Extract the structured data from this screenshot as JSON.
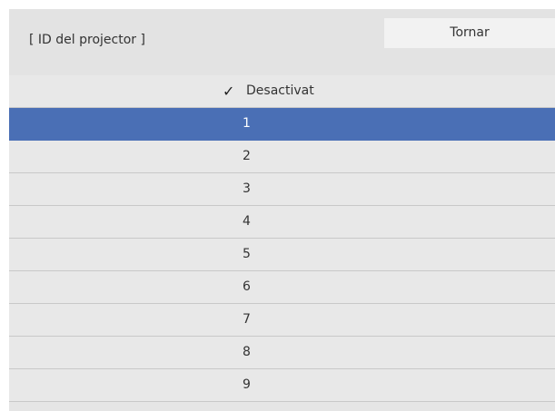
{
  "header": {
    "title": "[ ID del projector ]",
    "back_label": "Tornar"
  },
  "list": {
    "items": [
      {
        "label": "Desactivat",
        "checked": true,
        "selected": false
      },
      {
        "label": "1",
        "checked": false,
        "selected": true
      },
      {
        "label": "2",
        "checked": false,
        "selected": false
      },
      {
        "label": "3",
        "checked": false,
        "selected": false
      },
      {
        "label": "4",
        "checked": false,
        "selected": false
      },
      {
        "label": "5",
        "checked": false,
        "selected": false
      },
      {
        "label": "6",
        "checked": false,
        "selected": false
      },
      {
        "label": "7",
        "checked": false,
        "selected": false
      },
      {
        "label": "8",
        "checked": false,
        "selected": false
      },
      {
        "label": "9",
        "checked": false,
        "selected": false
      }
    ]
  },
  "colors": {
    "highlight": "#4a6fb5",
    "background": "#e7e7e7"
  }
}
